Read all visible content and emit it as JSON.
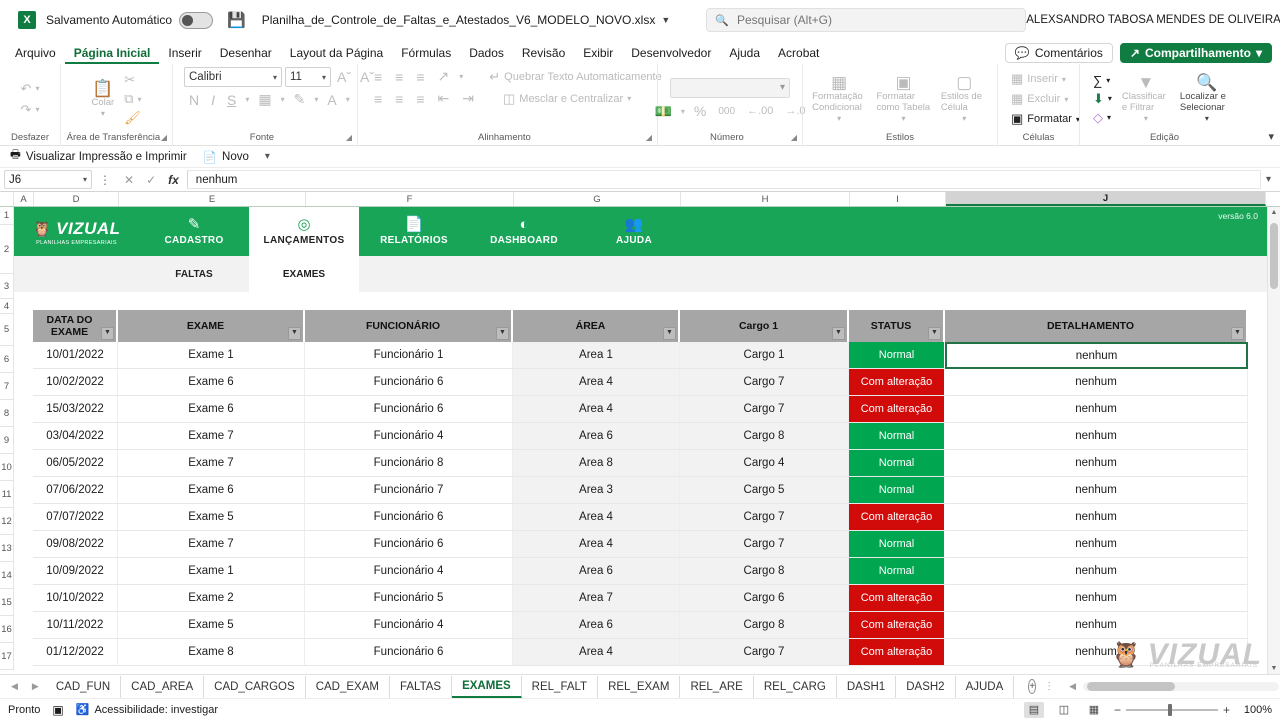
{
  "titlebar": {
    "app_icon": "excel-icon",
    "autosave_label": "Salvamento Automático",
    "autosave_state": "off",
    "save_icon": "save-icon",
    "document_title": "Planilha_de_Controle_de_Faltas_e_Atestados_V6_MODELO_NOVO.xlsx",
    "search_placeholder": "Pesquisar (Alt+G)",
    "search_value": "",
    "user_name": "ALEXSANDRO TABOSA MENDES DE OLIVEIRA",
    "minimize": "—",
    "restore": "❐",
    "close": "✕"
  },
  "ribbon_tabs": {
    "items": [
      {
        "label": "Arquivo",
        "active": false
      },
      {
        "label": "Página Inicial",
        "active": true
      },
      {
        "label": "Inserir",
        "active": false
      },
      {
        "label": "Desenhar",
        "active": false
      },
      {
        "label": "Layout da Página",
        "active": false
      },
      {
        "label": "Fórmulas",
        "active": false
      },
      {
        "label": "Dados",
        "active": false
      },
      {
        "label": "Revisão",
        "active": false
      },
      {
        "label": "Exibir",
        "active": false
      },
      {
        "label": "Desenvolvedor",
        "active": false
      },
      {
        "label": "Ajuda",
        "active": false
      },
      {
        "label": "Acrobat",
        "active": false
      }
    ],
    "comments_label": "Comentários",
    "share_label": "Compartilhamento"
  },
  "ribbon": {
    "groups": [
      {
        "name": "Desfazer",
        "label": "Desfazer"
      },
      {
        "name": "Área de Transferência",
        "label": "Área de Transferência",
        "paste_label": "Colar"
      },
      {
        "name": "Fonte",
        "label": "Fonte",
        "font_name": "Calibri",
        "font_size": "11",
        "bold": "N",
        "italic": "I",
        "underline": "S"
      },
      {
        "name": "Alinhamento",
        "label": "Alinhamento",
        "wrap_label": "Quebrar Texto Automaticamente",
        "merge_label": "Mesclar e Centralizar"
      },
      {
        "name": "Número",
        "label": "Número",
        "format_value": ""
      },
      {
        "name": "Estilos",
        "label": "Estilos",
        "cond_label": "Formatação Condicional",
        "table_label": "Formatar como Tabela",
        "cell_label": "Estilos de Célula"
      },
      {
        "name": "Células",
        "label": "Células",
        "insert_label": "Inserir",
        "delete_label": "Excluir",
        "format_label": "Formatar"
      },
      {
        "name": "Edição",
        "label": "Edição",
        "sort_label": "Classificar e Filtrar",
        "find_label": "Localizar e Selecionar"
      }
    ]
  },
  "qat": {
    "print_preview_label": "Visualizar Impressão e Imprimir",
    "new_label": "Novo"
  },
  "formula_bar": {
    "name_box": "J6",
    "cancel_icon": "cancel-icon",
    "confirm_icon": "confirm-icon",
    "fx_icon": "fx",
    "value": "nenhum"
  },
  "grid": {
    "columns": [
      "A",
      "D",
      "E",
      "F",
      "G",
      "H",
      "I",
      "J"
    ],
    "selected_column": "J",
    "rows": [
      "1",
      "2",
      "3",
      "4",
      "5",
      "6",
      "7",
      "8",
      "9",
      "10",
      "11",
      "12",
      "13",
      "14",
      "15",
      "16",
      "17"
    ],
    "selected_row": "6"
  },
  "app_header": {
    "brand_name": "VIZUAL",
    "brand_sub": "PLANILHAS EMPRESARIAIS",
    "brand_icon": "owl-icon",
    "version": "versão 6.0",
    "nav": [
      {
        "label": "CADASTRO",
        "icon": "pencil-icon",
        "active": false
      },
      {
        "label": "LANÇAMENTOS",
        "icon": "target-icon",
        "active": true
      },
      {
        "label": "RELATÓRIOS",
        "icon": "document-icon",
        "active": false
      },
      {
        "label": "DASHBOARD",
        "icon": "pie-chart-icon",
        "active": false
      },
      {
        "label": "AJUDA",
        "icon": "help-user-icon",
        "active": false
      }
    ],
    "subnav": [
      {
        "label": "FALTAS",
        "active": false
      },
      {
        "label": "EXAMES",
        "active": true
      }
    ]
  },
  "table": {
    "headers": [
      "DATA DO EXAME",
      "EXAME",
      "FUNCIONÁRIO",
      "ÁREA",
      "Cargo 1",
      "STATUS",
      "DETALHAMENTO"
    ],
    "rows": [
      {
        "data": "10/01/2022",
        "exame": "Exame 1",
        "funcionario": "Funcionário 1",
        "area": "Area 1",
        "cargo": "Cargo 1",
        "status": "Normal",
        "detalhamento": "nenhum"
      },
      {
        "data": "10/02/2022",
        "exame": "Exame 6",
        "funcionario": "Funcionário 6",
        "area": "Area 4",
        "cargo": "Cargo 7",
        "status": "Com alteração",
        "detalhamento": "nenhum"
      },
      {
        "data": "15/03/2022",
        "exame": "Exame 6",
        "funcionario": "Funcionário 6",
        "area": "Area 4",
        "cargo": "Cargo 7",
        "status": "Com alteração",
        "detalhamento": "nenhum"
      },
      {
        "data": "03/04/2022",
        "exame": "Exame 7",
        "funcionario": "Funcionário 4",
        "area": "Area 6",
        "cargo": "Cargo 8",
        "status": "Normal",
        "detalhamento": "nenhum"
      },
      {
        "data": "06/05/2022",
        "exame": "Exame 7",
        "funcionario": "Funcionário 8",
        "area": "Area 8",
        "cargo": "Cargo 4",
        "status": "Normal",
        "detalhamento": "nenhum"
      },
      {
        "data": "07/06/2022",
        "exame": "Exame 6",
        "funcionario": "Funcionário 7",
        "area": "Area 3",
        "cargo": "Cargo 5",
        "status": "Normal",
        "detalhamento": "nenhum"
      },
      {
        "data": "07/07/2022",
        "exame": "Exame 5",
        "funcionario": "Funcionário 6",
        "area": "Area 4",
        "cargo": "Cargo 7",
        "status": "Com alteração",
        "detalhamento": "nenhum"
      },
      {
        "data": "09/08/2022",
        "exame": "Exame 7",
        "funcionario": "Funcionário 6",
        "area": "Area 4",
        "cargo": "Cargo 7",
        "status": "Normal",
        "detalhamento": "nenhum"
      },
      {
        "data": "10/09/2022",
        "exame": "Exame 1",
        "funcionario": "Funcionário 4",
        "area": "Area 6",
        "cargo": "Cargo 8",
        "status": "Normal",
        "detalhamento": "nenhum"
      },
      {
        "data": "10/10/2022",
        "exame": "Exame 2",
        "funcionario": "Funcionário 5",
        "area": "Area 7",
        "cargo": "Cargo 6",
        "status": "Com alteração",
        "detalhamento": "nenhum"
      },
      {
        "data": "10/11/2022",
        "exame": "Exame 5",
        "funcionario": "Funcionário 4",
        "area": "Area 6",
        "cargo": "Cargo 8",
        "status": "Com alteração",
        "detalhamento": "nenhum"
      },
      {
        "data": "01/12/2022",
        "exame": "Exame 8",
        "funcionario": "Funcionário 6",
        "area": "Area 4",
        "cargo": "Cargo 7",
        "status": "Com alteração",
        "detalhamento": "nenhum"
      }
    ]
  },
  "watermark": {
    "text": "VIZUAL",
    "sub": "PLANILHAS EMPRESARIAIS"
  },
  "sheet_tabs": {
    "items": [
      {
        "label": "CAD_FUN",
        "active": false
      },
      {
        "label": "CAD_AREA",
        "active": false
      },
      {
        "label": "CAD_CARGOS",
        "active": false
      },
      {
        "label": "CAD_EXAM",
        "active": false
      },
      {
        "label": "FALTAS",
        "active": false
      },
      {
        "label": "EXAMES",
        "active": true
      },
      {
        "label": "REL_FALT",
        "active": false
      },
      {
        "label": "REL_EXAM",
        "active": false
      },
      {
        "label": "REL_ARE",
        "active": false
      },
      {
        "label": "REL_CARG",
        "active": false
      },
      {
        "label": "DASH1",
        "active": false
      },
      {
        "label": "DASH2",
        "active": false
      },
      {
        "label": "AJUDA",
        "active": false
      }
    ],
    "add_label": "+"
  },
  "statusbar": {
    "mode": "Pronto",
    "macro_icon": "record-macro-icon",
    "accessibility": "Acessibilidade: investigar",
    "zoom": "100%"
  },
  "colors": {
    "brand_green": "#18a558",
    "excel_green": "#107c41",
    "status_normal": "#00a650",
    "status_alt": "#d10a0a",
    "header_gray": "#a6a6a6"
  }
}
